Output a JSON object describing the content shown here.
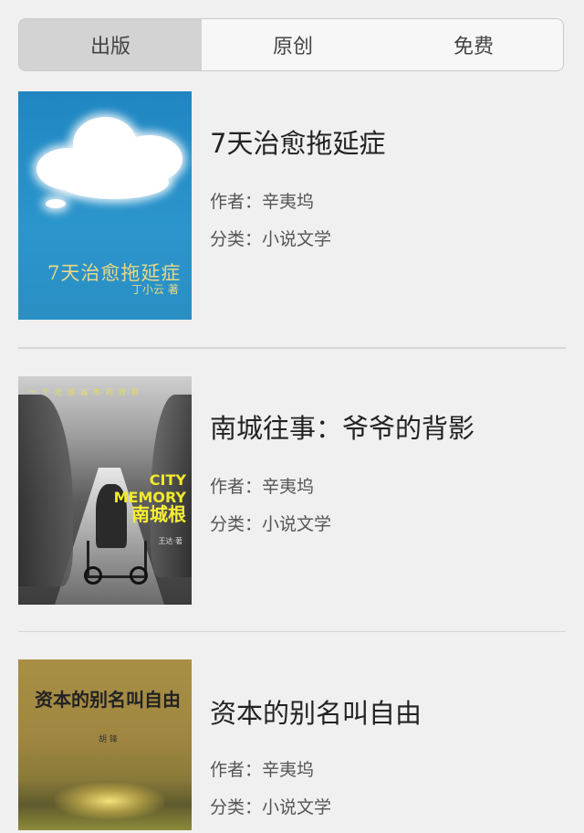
{
  "tabs": [
    {
      "label": "出版",
      "active": true
    },
    {
      "label": "原创",
      "active": false
    },
    {
      "label": "免费",
      "active": false
    }
  ],
  "books": [
    {
      "title": "7天治愈拖延症",
      "author_key": "作者：",
      "author": "辛夷坞",
      "category_key": "分类：",
      "category": "小说文学",
      "cover": {
        "title": "7天治愈拖延症",
        "author": "丁小云 著"
      }
    },
    {
      "title": "南城往事：爷爷的背影",
      "author_key": "作者：",
      "author": "辛夷坞",
      "category_key": "分类：",
      "category": "小说文学",
      "cover": {
        "top_text": "一个北国城市的背影",
        "en_line1": "CITY",
        "en_line2": "MEMORY",
        "zh": "南城根",
        "sig": "王达·著"
      }
    },
    {
      "title": "资本的别名叫自由",
      "author_key": "作者：",
      "author": "辛夷坞",
      "category_key": "分类：",
      "category": "小说文学",
      "cover": {
        "title": "资本的别名叫自由",
        "author": "胡 锋"
      }
    }
  ],
  "colors": {
    "background": "#f0f0f0",
    "segment_active": "#d3d3d3",
    "divider": "#d6d6d6"
  }
}
